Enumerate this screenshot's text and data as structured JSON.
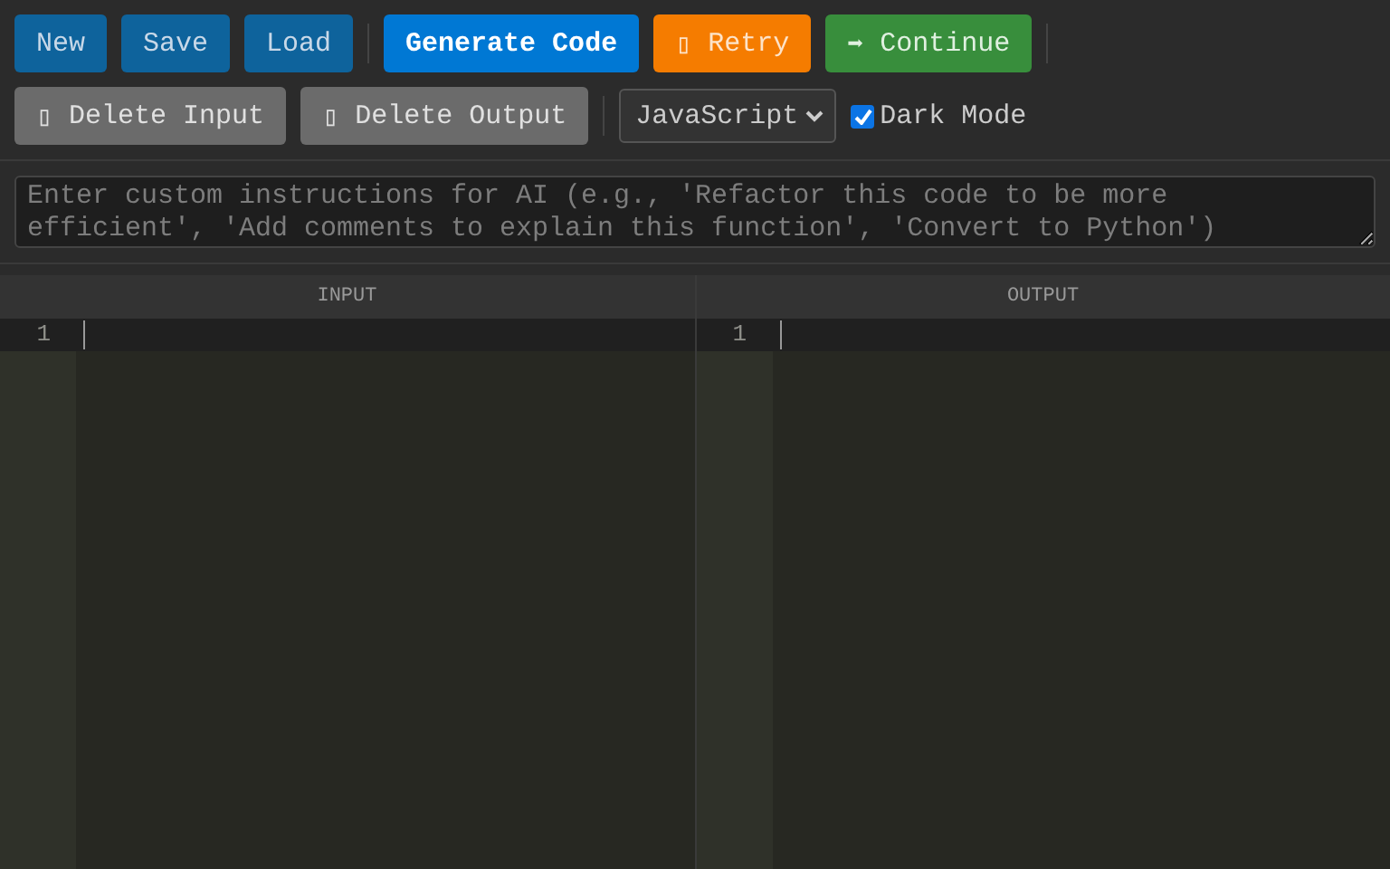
{
  "toolbar_rows": [
    [
      {
        "kind": "file",
        "label": "New"
      },
      {
        "kind": "file",
        "label": "Save"
      },
      {
        "kind": "file",
        "label": "Load"
      },
      {
        "kind": "separator"
      },
      {
        "kind": "primary",
        "label": "Generate Code"
      },
      {
        "kind": "warning",
        "glyph": "▯",
        "label": "Retry"
      },
      {
        "kind": "success",
        "glyph": "➡",
        "label": "Continue"
      },
      {
        "kind": "separator"
      }
    ],
    [
      {
        "kind": "muted",
        "glyph": "▯",
        "label": "Delete Input"
      },
      {
        "kind": "muted",
        "glyph": "▯",
        "label": "Delete Output"
      },
      {
        "kind": "separator"
      },
      {
        "kind": "select",
        "value": "JavaScript"
      },
      {
        "kind": "checkbox",
        "label": "Dark Mode",
        "checked": true
      }
    ]
  ],
  "instructions": {
    "placeholder": "Enter custom instructions for AI (e.g., 'Refactor this code to be more efficient', 'Add comments to explain this function', 'Convert to Python')"
  },
  "panes": [
    {
      "title": "INPUT",
      "lines": [
        "1"
      ]
    },
    {
      "title": "OUTPUT",
      "lines": [
        "1"
      ]
    }
  ]
}
